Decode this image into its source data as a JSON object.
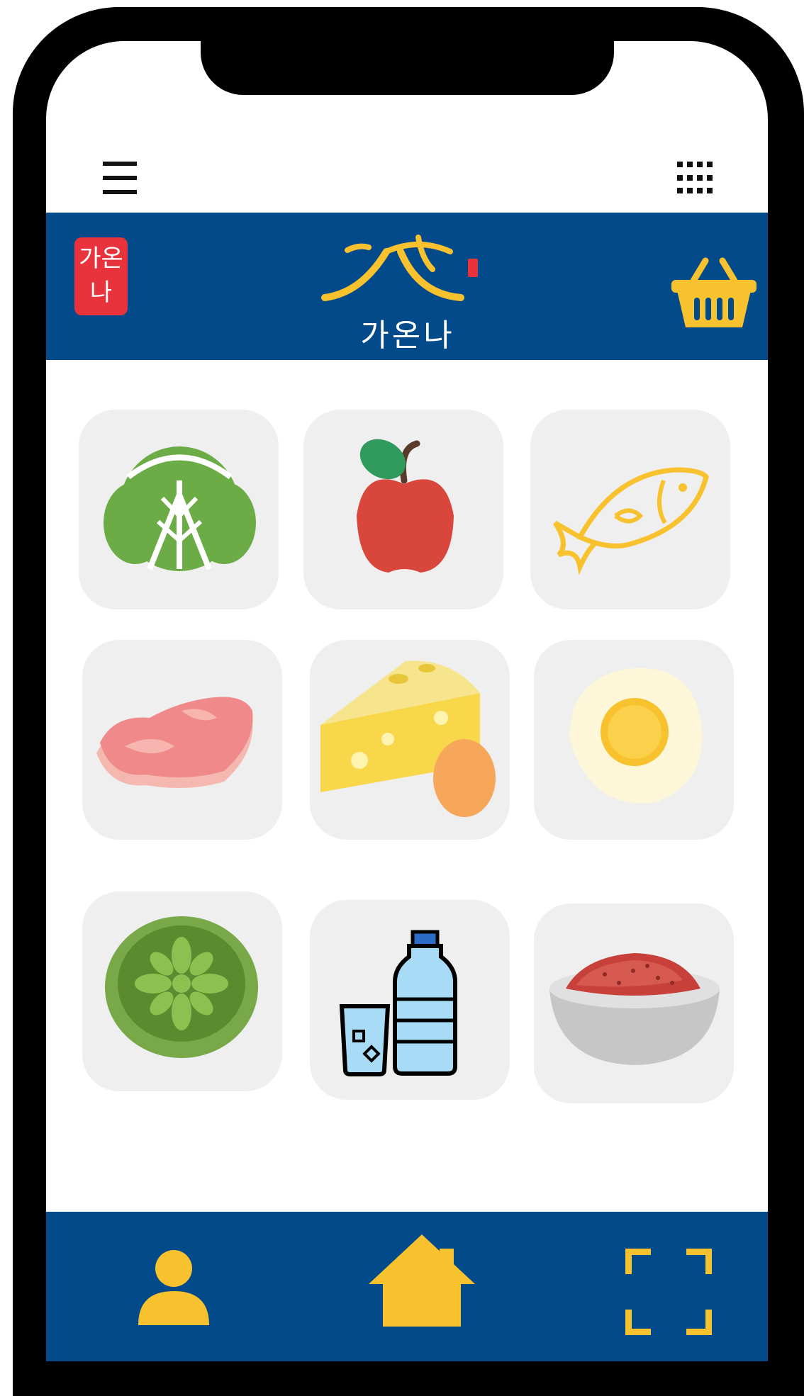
{
  "header": {
    "menu_icon": "hamburger-menu-icon",
    "apps_icon": "apps-grid-icon"
  },
  "brand": {
    "seal_text": "가온나",
    "logo_text": "가온나",
    "basket_icon": "shopping-basket-icon",
    "accent": "#f8c12e",
    "bar_color": "#034a8a",
    "seal_color": "#e8333c"
  },
  "categories": [
    {
      "icon": "cabbage-icon"
    },
    {
      "icon": "apple-icon"
    },
    {
      "icon": "fish-icon"
    },
    {
      "icon": "meat-icon"
    },
    {
      "icon": "cheese-egg-icon"
    },
    {
      "icon": "fried-egg-icon"
    },
    {
      "icon": "citrus-slice-icon"
    },
    {
      "icon": "water-bottle-icon"
    },
    {
      "icon": "red-paste-bowl-icon"
    }
  ],
  "bottom_nav": {
    "profile_icon": "user-icon",
    "home_icon": "home-icon",
    "scan_icon": "scan-frame-icon"
  }
}
